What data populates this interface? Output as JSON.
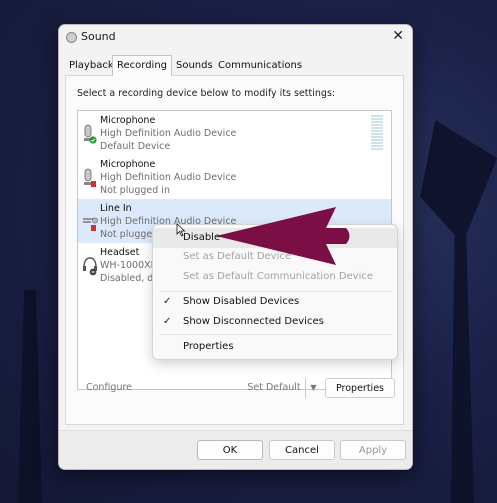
{
  "window": {
    "title": "Sound",
    "close_glyph": "✕"
  },
  "tabs": [
    {
      "label": "Playback"
    },
    {
      "label": "Recording",
      "active": true
    },
    {
      "label": "Sounds"
    },
    {
      "label": "Communications"
    }
  ],
  "instruction": "Select a recording device below to modify its settings:",
  "devices": [
    {
      "name": "Microphone",
      "line1": "High Definition Audio Device",
      "line2": "Default Device",
      "icon": "microphone-icon",
      "status": "default-check"
    },
    {
      "name": "Microphone",
      "line1": "High Definition Audio Device",
      "line2": "Not plugged in",
      "icon": "microphone-icon",
      "status": "unplugged"
    },
    {
      "name": "Line In",
      "line1": "High Definition Audio Device",
      "line2": "Not plugged",
      "icon": "line-in-icon",
      "status": "unplugged",
      "selected": true
    },
    {
      "name": "Headset",
      "line1": "WH-1000XM",
      "line2": "Disabled, dis",
      "icon": "headset-icon",
      "status": "disabled"
    }
  ],
  "buttons": {
    "configure": "Configure",
    "set_default": "Set Default",
    "properties": "Properties"
  },
  "context_menu": [
    {
      "label": "Disable",
      "enabled": true
    },
    {
      "label": "Set as Default Device",
      "enabled": false
    },
    {
      "label": "Set as Default Communication Device",
      "enabled": false
    },
    {
      "label": "Show Disabled Devices",
      "checked": true,
      "enabled": true
    },
    {
      "label": "Show Disconnected Devices",
      "checked": true,
      "enabled": true
    },
    {
      "label": "Properties",
      "enabled": true
    }
  ],
  "check_glyph": "✓",
  "footer": {
    "ok": "OK",
    "cancel": "Cancel",
    "apply": "Apply"
  },
  "colors": {
    "annotation_arrow": "#7a0e45",
    "selection": "#dbe9fa",
    "status_green": "#1f9a3b",
    "status_red": "#d2322d"
  }
}
